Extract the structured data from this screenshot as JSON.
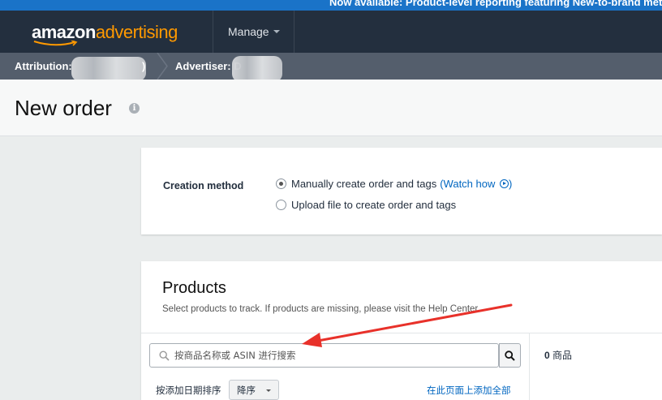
{
  "banner": {
    "text": "Now available: Product-level reporting featuring New-to-brand metrics"
  },
  "header": {
    "logo_part1": "amazon",
    "logo_part2": "advertising",
    "manage_label": "Manage"
  },
  "breadcrumb": {
    "attribution": "Attribution:",
    "paren_close": ")",
    "advertiser": "Advertiser: D"
  },
  "page": {
    "title": "New order"
  },
  "creation": {
    "label": "Creation method",
    "option1": "Manually create order and tags",
    "watch_link": "(Watch how",
    "watch_close": ")",
    "option2": "Upload file to create order and tags",
    "selected_option": "option1"
  },
  "products": {
    "title": "Products",
    "subtitle": "Select products to track. If products are missing, please visit the Help Center.",
    "search_placeholder": "按商品名称或 ASIN 进行搜索",
    "count_number": "0",
    "count_unit": "商品",
    "sort_label": "按添加日期排序",
    "sort_value": "降序",
    "add_all": "在此页面上添加全部"
  },
  "colors": {
    "nav_bg": "#232f3e",
    "brand_orange": "#ff9900",
    "link_blue": "#0066c0",
    "banner_blue": "#1a73c8",
    "annotation_red": "#e8312a"
  }
}
